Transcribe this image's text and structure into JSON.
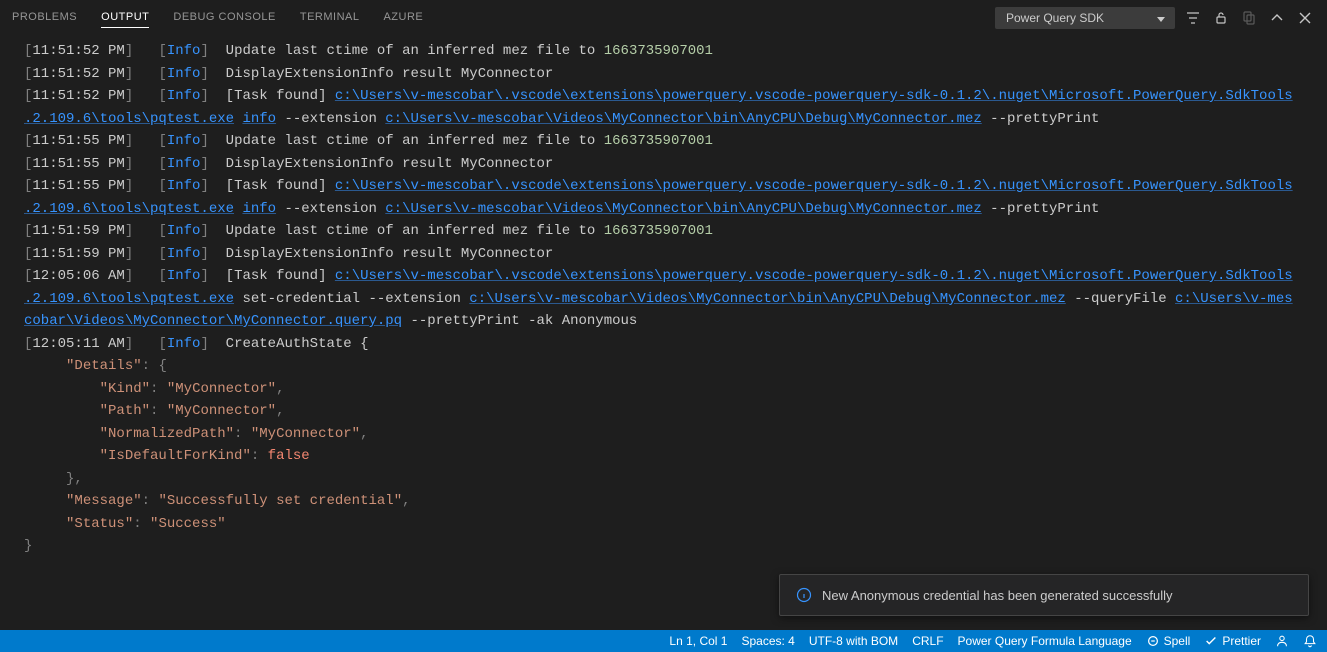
{
  "panel": {
    "tabs": [
      "PROBLEMS",
      "OUTPUT",
      "DEBUG CONSOLE",
      "TERMINAL",
      "AZURE"
    ],
    "active_tab": "OUTPUT",
    "channel": "Power Query SDK"
  },
  "logs": [
    {
      "time": "11:51:52 PM",
      "level": "Info",
      "segments": [
        {
          "t": "msg",
          "v": "Update last ctime of an inferred mez file to "
        },
        {
          "t": "num",
          "v": "1663735907001"
        }
      ]
    },
    {
      "time": "11:51:52 PM",
      "level": "Info",
      "segments": [
        {
          "t": "msg",
          "v": "DisplayExtensionInfo result MyConnector"
        }
      ]
    },
    {
      "time": "11:51:52 PM",
      "level": "Info",
      "segments": [
        {
          "t": "msg",
          "v": "[Task found] "
        },
        {
          "t": "path",
          "v": "c:\\Users\\v-mescobar\\.vscode\\extensions\\powerquery.vscode-powerquery-sdk-0.1.2\\.nuget\\Microsoft.PowerQuery.SdkTools.2.109.6\\tools\\pqtest.exe"
        },
        {
          "t": "arg",
          "v": " "
        },
        {
          "t": "path",
          "v": "info"
        },
        {
          "t": "arg",
          "v": " --extension "
        },
        {
          "t": "path",
          "v": "c:\\Users\\v-mescobar\\Videos\\MyConnector\\bin\\AnyCPU\\Debug\\MyConnector.mez"
        },
        {
          "t": "arg",
          "v": " --prettyPrint"
        }
      ]
    },
    {
      "time": "11:51:55 PM",
      "level": "Info",
      "segments": [
        {
          "t": "msg",
          "v": "Update last ctime of an inferred mez file to "
        },
        {
          "t": "num",
          "v": "1663735907001"
        }
      ]
    },
    {
      "time": "11:51:55 PM",
      "level": "Info",
      "segments": [
        {
          "t": "msg",
          "v": "DisplayExtensionInfo result MyConnector"
        }
      ]
    },
    {
      "time": "11:51:55 PM",
      "level": "Info",
      "segments": [
        {
          "t": "msg",
          "v": "[Task found] "
        },
        {
          "t": "path",
          "v": "c:\\Users\\v-mescobar\\.vscode\\extensions\\powerquery.vscode-powerquery-sdk-0.1.2\\.nuget\\Microsoft.PowerQuery.SdkTools.2.109.6\\tools\\pqtest.exe"
        },
        {
          "t": "arg",
          "v": " "
        },
        {
          "t": "path",
          "v": "info"
        },
        {
          "t": "arg",
          "v": " --extension "
        },
        {
          "t": "path",
          "v": "c:\\Users\\v-mescobar\\Videos\\MyConnector\\bin\\AnyCPU\\Debug\\MyConnector.mez"
        },
        {
          "t": "arg",
          "v": " --prettyPrint"
        }
      ]
    },
    {
      "time": "11:51:59 PM",
      "level": "Info",
      "segments": [
        {
          "t": "msg",
          "v": "Update last ctime of an inferred mez file to "
        },
        {
          "t": "num",
          "v": "1663735907001"
        }
      ]
    },
    {
      "time": "11:51:59 PM",
      "level": "Info",
      "segments": [
        {
          "t": "msg",
          "v": "DisplayExtensionInfo result MyConnector"
        }
      ]
    },
    {
      "time": "12:05:06 AM",
      "level": "Info",
      "segments": [
        {
          "t": "msg",
          "v": "[Task found] "
        },
        {
          "t": "path",
          "v": "c:\\Users\\v-mescobar\\.vscode\\extensions\\powerquery.vscode-powerquery-sdk-0.1.2\\.nuget\\Microsoft.PowerQuery.SdkTools.2.109.6\\tools\\pqtest.exe"
        },
        {
          "t": "arg",
          "v": " set-credential --extension "
        },
        {
          "t": "path",
          "v": "c:\\Users\\v-mescobar\\Videos\\MyConnector\\bin\\AnyCPU\\Debug\\MyConnector.mez"
        },
        {
          "t": "arg",
          "v": " --queryFile "
        },
        {
          "t": "path",
          "v": "c:\\Users\\v-mescobar\\Videos\\MyConnector\\MyConnector.query.pq"
        },
        {
          "t": "arg",
          "v": " --prettyPrint -ak Anonymous"
        }
      ]
    },
    {
      "time": "12:05:11 AM",
      "level": "Info",
      "segments": [
        {
          "t": "msg",
          "v": "CreateAuthState {"
        }
      ],
      "json_block": true
    }
  ],
  "json_output": {
    "Details": {
      "Kind": "MyConnector",
      "Path": "MyConnector",
      "NormalizedPath": "MyConnector",
      "IsDefaultForKind": false
    },
    "Message": "Successfully set credential",
    "Status": "Success"
  },
  "notification": {
    "message": "New Anonymous credential has been generated successfully"
  },
  "statusbar": {
    "cursor": "Ln 1, Col 1",
    "spaces": "Spaces: 4",
    "encoding": "UTF-8 with BOM",
    "eol": "CRLF",
    "language": "Power Query Formula Language",
    "spell": "Spell",
    "prettier": "Prettier"
  }
}
